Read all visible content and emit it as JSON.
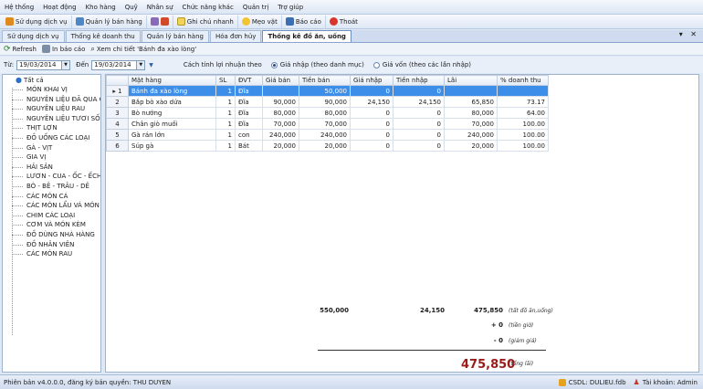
{
  "menu": [
    "Hệ thống",
    "Hoạt động",
    "Kho hàng",
    "Quỹ",
    "Nhân sự",
    "Chức năng khác",
    "Quản trị",
    "Trợ giúp"
  ],
  "quickbar": {
    "dich_vu": "Sử dụng dịch vụ",
    "ban_hang": "Quản lý bán hàng",
    "ghi_chu": "Ghi chú nhanh",
    "meo_vat": "Mẹo vặt",
    "bao_cao": "Báo cáo",
    "thoat": "Thoát"
  },
  "tabs": [
    "Sử dụng dịch vụ",
    "Thống kê doanh thu",
    "Quản lý bán hàng",
    "Hóa đơn hủy",
    "Thống kê đồ ăn, uống"
  ],
  "tab_close_glyphs": "▾ ✕",
  "toolbar": {
    "refresh": "Refresh",
    "print": "In báo cáo",
    "detail": "Xem chi tiết 'Bánh đa xào lòng'"
  },
  "filters": {
    "from_label": "Từ:",
    "from": "19/03/2014",
    "to_label": "Đến",
    "to": "19/03/2014",
    "profit_label": "Cách tính lợi nhuận theo",
    "opt1": "Giá nhập (theo danh mục)",
    "opt2": "Giá vốn (theo các lần nhập)"
  },
  "tree": {
    "root": "Tất cả",
    "items": [
      "MÓN KHAI VỊ",
      "NGUYÊN LIỆU ĐÃ QUA CHẾ",
      "NGUYÊN LIỆU RAU",
      "NGUYÊN LIỆU TƯƠI SỐNG",
      "THỊT LỢN",
      "ĐỒ UỐNG CÁC LOẠI",
      "GÀ - VỊT",
      "GIA VỊ",
      "HẢI SẢN",
      "LƯƠN - CUA - ỐC - ẾCH",
      "BÒ - BÊ - TRÂU - DÊ",
      "CÁC MÓN CÁ",
      "CÁC MÓN LẨU VÀ MÓN ĂN",
      "CHIM CÁC LOẠI",
      "CƠM VÀ MÓN KÈM",
      "ĐỒ DÙNG NHÀ HÀNG",
      "ĐỒ NHÂN VIÊN",
      "CÁC MÓN RAU"
    ]
  },
  "grid": {
    "columns": [
      "",
      "Mặt hàng",
      "SL",
      "ĐVT",
      "Giá bán",
      "Tiền bán",
      "Giá nhập",
      "Tiền nhập",
      "Lãi",
      "% doanh thu"
    ],
    "rows": [
      [
        "1",
        "Bánh đa xào lòng",
        "1",
        "Đĩa",
        "",
        "50,000",
        "0",
        "0",
        "",
        ""
      ],
      [
        "2",
        "Bắp bò xào dứa",
        "1",
        "Đĩa",
        "90,000",
        "90,000",
        "24,150",
        "24,150",
        "65,850",
        "73.17"
      ],
      [
        "3",
        "Bò nướng",
        "1",
        "Đĩa",
        "80,000",
        "80,000",
        "0",
        "0",
        "80,000",
        "64.00"
      ],
      [
        "4",
        "Chân giò muối",
        "1",
        "Đĩa",
        "70,000",
        "70,000",
        "0",
        "0",
        "70,000",
        "100.00"
      ],
      [
        "5",
        "Gà rán lớn",
        "1",
        "con",
        "240,000",
        "240,000",
        "0",
        "0",
        "240,000",
        "100.00"
      ],
      [
        "6",
        "Súp gà",
        "1",
        "Bát",
        "20,000",
        "20,000",
        "0",
        "0",
        "20,000",
        "100.00"
      ]
    ]
  },
  "summary": {
    "tien_ban": "550,000",
    "tien_nhap": "24,150",
    "tong_do_an": "475,850",
    "tong_do_an_label": "(tất đồ ăn,uống)",
    "tien_gio": "+ 0",
    "tien_gio_label": "(tiền giờ)",
    "giam_gia": "- 0",
    "giam_gia_label": "(giảm giá)",
    "tong_lai": "475,850",
    "tong_lai_label": "(tổng lãi)"
  },
  "status": {
    "version": "Phiên bản v4.0.0.0, đăng ký bản quyền: THU DUYEN",
    "db": "CSDL: DULIEU.fdb",
    "account": "Tài khoản: Admin"
  },
  "colors": {
    "accent": "#3c8ee8",
    "total": "#9b1b1b"
  }
}
